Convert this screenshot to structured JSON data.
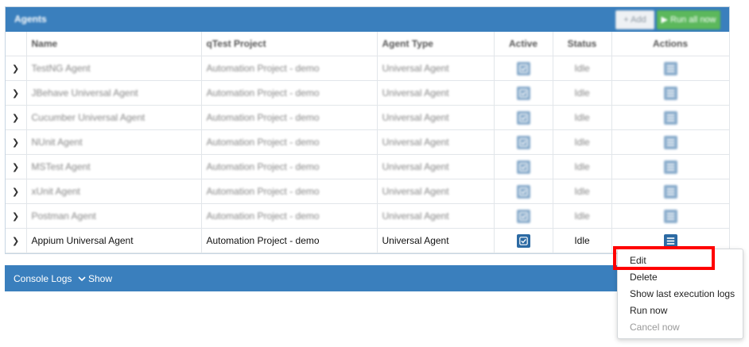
{
  "panel": {
    "title": "Agents",
    "add_label": "+ Add",
    "run_all_label": "▶ Run all now"
  },
  "table": {
    "headers": {
      "name": "Name",
      "project": "qTest Project",
      "type": "Agent Type",
      "active": "Active",
      "status": "Status",
      "actions": "Actions"
    },
    "rows": [
      {
        "name": "TestNG Agent",
        "project": "Automation Project - demo",
        "type": "Universal Agent",
        "status": "Idle"
      },
      {
        "name": "JBehave Universal Agent",
        "project": "Automation Project - demo",
        "type": "Universal Agent",
        "status": "Idle"
      },
      {
        "name": "Cucumber Universal Agent",
        "project": "Automation Project - demo",
        "type": "Universal Agent",
        "status": "Idle"
      },
      {
        "name": "NUnit Agent",
        "project": "Automation Project - demo",
        "type": "Universal Agent",
        "status": "Idle"
      },
      {
        "name": "MSTest Agent",
        "project": "Automation Project - demo",
        "type": "Universal Agent",
        "status": "Idle"
      },
      {
        "name": "xUnit Agent",
        "project": "Automation Project - demo",
        "type": "Universal Agent",
        "status": "Idle"
      },
      {
        "name": "Postman Agent",
        "project": "Automation Project - demo",
        "type": "Universal Agent",
        "status": "Idle"
      },
      {
        "name": "Appium Universal Agent",
        "project": "Automation Project - demo",
        "type": "Universal Agent",
        "status": "Idle"
      }
    ]
  },
  "console": {
    "title": "Console Logs",
    "toggle_label": "Show"
  },
  "menu": {
    "edit": "Edit",
    "delete": "Delete",
    "show_logs": "Show last execution logs",
    "run_now": "Run now",
    "cancel_now": "Cancel now"
  },
  "colors": {
    "header_blue": "#3a7fbd",
    "icon_blue": "#2c6aa3",
    "run_green": "#5cb85c",
    "highlight_red": "#ff0000"
  }
}
